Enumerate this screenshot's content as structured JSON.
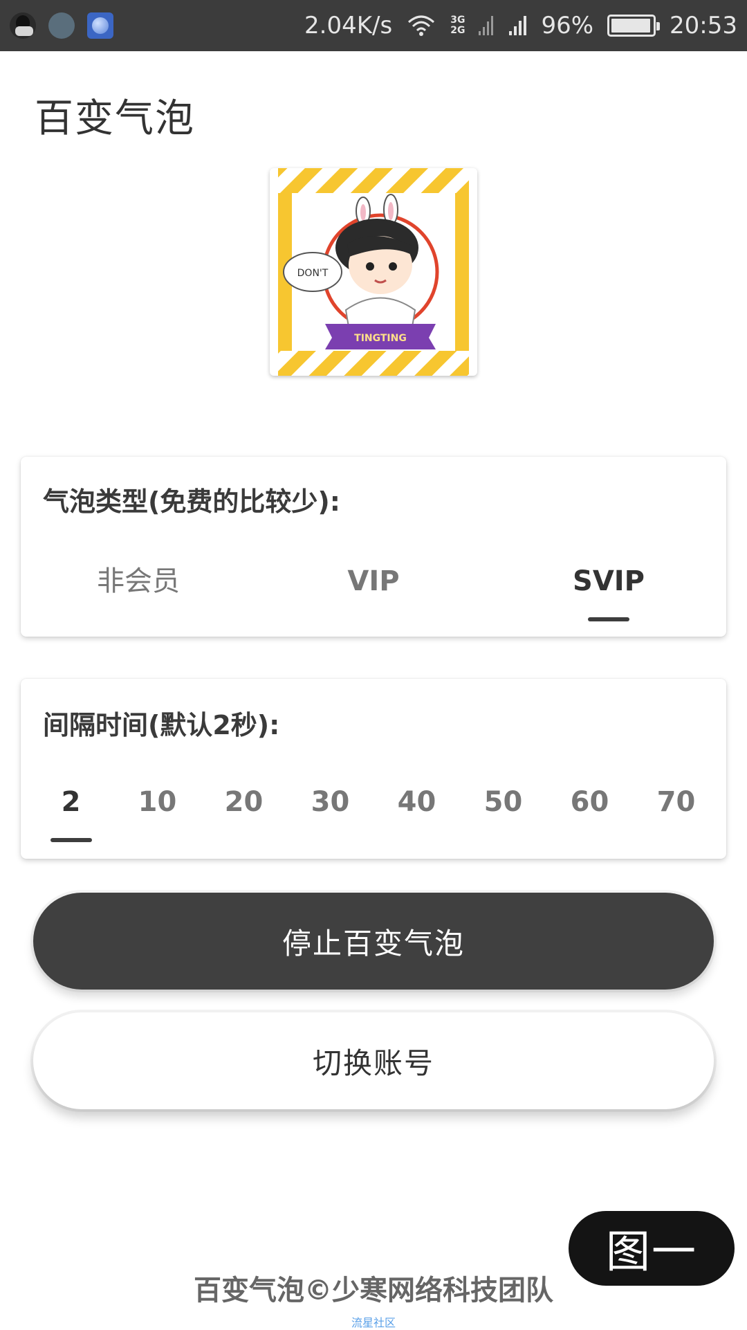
{
  "status_bar": {
    "net_speed": "2.04K/s",
    "net_types": [
      "3G",
      "2G"
    ],
    "battery_percent": "96%",
    "battery_level": 0.96,
    "time": "20:53"
  },
  "app": {
    "title": "百变气泡"
  },
  "bubble_type": {
    "title": "气泡类型(免费的比较少):",
    "tabs": [
      "非会员",
      "VIP",
      "SVIP"
    ],
    "selected_index": 2
  },
  "interval": {
    "title": "间隔时间(默认2秒):",
    "tabs": [
      "2",
      "10",
      "20",
      "30",
      "40",
      "50",
      "60",
      "70"
    ],
    "selected_index": 0
  },
  "buttons": {
    "stop": "停止百变气泡",
    "switch_account": "切换账号"
  },
  "footer": {
    "copyright": "百变气泡©少寒网络科技团队",
    "watermark": "流星社区"
  },
  "overlay": {
    "figure_label": "图一"
  },
  "colors": {
    "status_bar": "#3c3c3c",
    "primary_dark": "#404040",
    "indicator": "#3d3d3d",
    "avatar_frame": "#f7c630"
  }
}
